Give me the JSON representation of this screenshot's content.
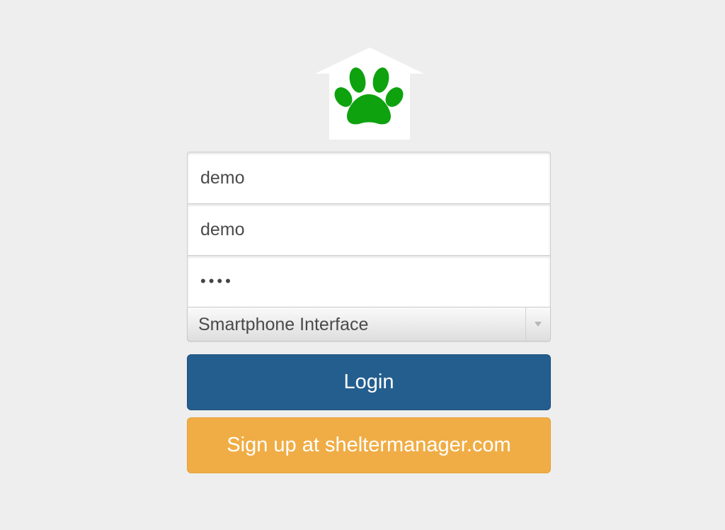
{
  "logo": {
    "icon": "paw-house-icon",
    "paw_color": "#0ea20e",
    "house_color": "#ffffff"
  },
  "login_form": {
    "database_value": "demo",
    "username_value": "demo",
    "password_value": "••••",
    "interface_select": {
      "selected": "Smartphone Interface",
      "arrow_icon": "chevron-down-icon"
    },
    "login_label": "Login",
    "signup_label": "Sign up at sheltermanager.com"
  },
  "colors": {
    "background": "#eeeeee",
    "login_button": "#245e8f",
    "signup_button": "#f0ad45"
  }
}
